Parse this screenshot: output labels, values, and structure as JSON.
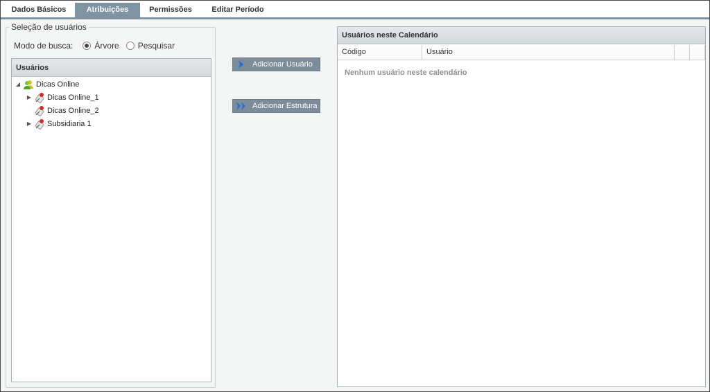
{
  "tabs": [
    {
      "label": "Dados Básicos",
      "active": false
    },
    {
      "label": "Atribuições",
      "active": true
    },
    {
      "label": "Permissões",
      "active": false
    },
    {
      "label": "Editar Período",
      "active": false
    }
  ],
  "selection": {
    "legend": "Seleção de usuários",
    "mode_label": "Modo de busca:",
    "options": [
      {
        "label": "Árvore",
        "checked": true
      },
      {
        "label": "Pesquisar",
        "checked": false
      }
    ]
  },
  "tree": {
    "header": "Usuários",
    "nodes": [
      {
        "label": "Dicas Online",
        "icon": "group-users-icon",
        "expander": "expanded"
      },
      {
        "label": "Dicas Online_1",
        "icon": "user-pin-icon",
        "expander": "collapsed"
      },
      {
        "label": "Dicas Online_2",
        "icon": "user-pin-icon",
        "expander": "none"
      },
      {
        "label": "Subsidiaria 1",
        "icon": "user-pin-icon",
        "expander": "collapsed"
      }
    ]
  },
  "actions": {
    "add_user": "Adicionar Usuário",
    "add_structure": "Adicionar Estrutura"
  },
  "grid": {
    "title": "Usuários neste Calendário",
    "columns": [
      "Código",
      "Usuário"
    ],
    "empty_message": "Nenhum usuário neste calendário"
  },
  "colors": {
    "tab_active": "#7f94a3",
    "button": "#7c8c98",
    "accent_arrow": "#1e6fd9"
  }
}
